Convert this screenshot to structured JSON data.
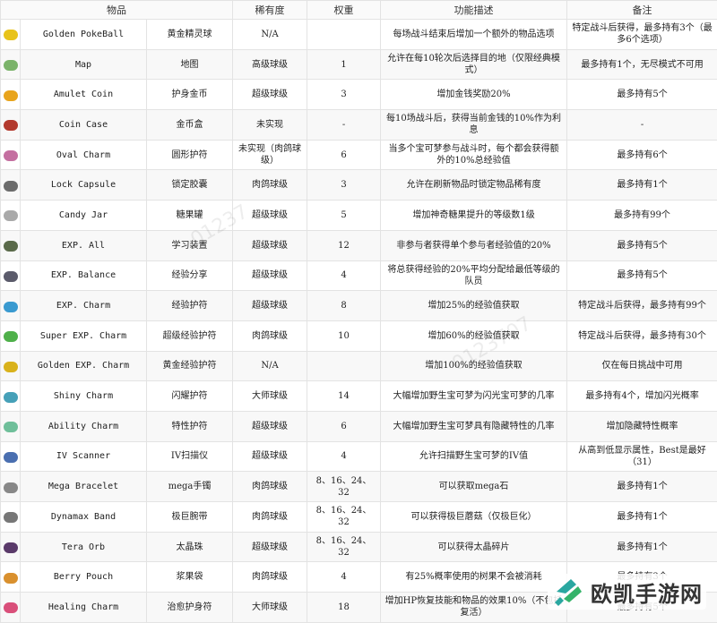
{
  "table": {
    "headers": [
      "物品",
      "稀有度",
      "权重",
      "功能描述",
      "备注"
    ],
    "rows": [
      {
        "icon": "golden-pokeball-icon",
        "color": "#e8c31a",
        "en": "Golden PokeBall",
        "zh": "黄金精灵球",
        "rarity": "N/A",
        "weight": "",
        "desc": "每场战斗结束后增加一个额外的物品选项",
        "note": "特定战斗后获得，最多持有3个（最多6个选项）"
      },
      {
        "icon": "map-icon",
        "color": "#7bb36a",
        "en": "Map",
        "zh": "地图",
        "rarity": "高级球级",
        "weight": "1",
        "desc": "允许在每10轮次后选择目的地（仅限经典模式）",
        "note": "最多持有1个，无尽模式不可用"
      },
      {
        "icon": "amulet-coin-icon",
        "color": "#e8a41c",
        "en": "Amulet Coin",
        "zh": "护身金币",
        "rarity": "超级球级",
        "weight": "3",
        "desc": "增加金钱奖励20%",
        "note": "最多持有5个"
      },
      {
        "icon": "coin-case-icon",
        "color": "#b33a2e",
        "en": "Coin Case",
        "zh": "金币盒",
        "rarity": "未实现",
        "weight": "-",
        "desc": "每10场战斗后，获得当前金钱的10%作为利息",
        "note": "-"
      },
      {
        "icon": "oval-charm-icon",
        "color": "#c46fa0",
        "en": "Oval Charm",
        "zh": "圆形护符",
        "rarity": "未实现（肉鸽球级）",
        "weight": "6",
        "desc": "当多个宝可梦参与战斗时，每个都会获得额外的10%总经验值",
        "note": "最多持有6个"
      },
      {
        "icon": "lock-capsule-icon",
        "color": "#6c6c6c",
        "en": "Lock Capsule",
        "zh": "锁定胶囊",
        "rarity": "肉鸽球级",
        "weight": "3",
        "desc": "允许在刷新物品时锁定物品稀有度",
        "note": "最多持有1个"
      },
      {
        "icon": "candy-jar-icon",
        "color": "#a9a9a9",
        "en": "Candy Jar",
        "zh": "糖果罐",
        "rarity": "超级球级",
        "weight": "5",
        "desc": "增加神奇糖果提升的等级数1级",
        "note": "最多持有99个"
      },
      {
        "icon": "exp-all-icon",
        "color": "#5a6a4a",
        "en": "EXP. All",
        "zh": "学习装置",
        "rarity": "超级球级",
        "weight": "12",
        "desc": "非参与者获得单个参与者经验值的20%",
        "note": "最多持有5个"
      },
      {
        "icon": "exp-balance-icon",
        "color": "#5b5b6b",
        "en": "EXP. Balance",
        "zh": "经验分享",
        "rarity": "超级球级",
        "weight": "4",
        "desc": "将总获得经验的20%平均分配给最低等级的队员",
        "note": "最多持有5个"
      },
      {
        "icon": "exp-charm-icon",
        "color": "#3a9ad0",
        "en": "EXP. Charm",
        "zh": "经验护符",
        "rarity": "超级球级",
        "weight": "8",
        "desc": "增加25%的经验值获取",
        "note": "特定战斗后获得，最多持有99个"
      },
      {
        "icon": "super-exp-charm-icon",
        "color": "#4fb04a",
        "en": "Super EXP. Charm",
        "zh": "超级经验护符",
        "rarity": "肉鸽球级",
        "weight": "10",
        "desc": "增加60%的经验值获取",
        "note": "特定战斗后获得，最多持有30个"
      },
      {
        "icon": "golden-exp-charm-icon",
        "color": "#d9b21c",
        "en": "Golden EXP. Charm",
        "zh": "黄金经验护符",
        "rarity": "N/A",
        "weight": "",
        "desc": "增加100%的经验值获取",
        "note": "仅在每日挑战中可用"
      },
      {
        "icon": "shiny-charm-icon",
        "color": "#46a0b8",
        "en": "Shiny Charm",
        "zh": "闪耀护符",
        "rarity": "大师球级",
        "weight": "14",
        "desc": "大幅增加野生宝可梦为闪光宝可梦的几率",
        "note": "最多持有4个，增加闪光概率"
      },
      {
        "icon": "ability-charm-icon",
        "color": "#6fbf9a",
        "en": "Ability Charm",
        "zh": "特性护符",
        "rarity": "超级球级",
        "weight": "6",
        "desc": "大幅增加野生宝可梦具有隐藏特性的几率",
        "note": "增加隐藏特性概率"
      },
      {
        "icon": "iv-scanner-icon",
        "color": "#4a6fb0",
        "en": "IV Scanner",
        "zh": "IV扫描仪",
        "rarity": "超级球级",
        "weight": "4",
        "desc": "允许扫描野生宝可梦的IV值",
        "note": "从高到低显示属性，Best是最好（31）"
      },
      {
        "icon": "mega-bracelet-icon",
        "color": "#888888",
        "en": "Mega Bracelet",
        "zh": "mega手镯",
        "rarity": "肉鸽球级",
        "weight": "8、16、24、32",
        "desc": "可以获取mega石",
        "note": "最多持有1个"
      },
      {
        "icon": "dynamax-band-icon",
        "color": "#777777",
        "en": "Dynamax Band",
        "zh": "极巨腕带",
        "rarity": "肉鸽球级",
        "weight": "8、16、24、32",
        "desc": "可以获得极巨蘑菇（仅极巨化）",
        "note": "最多持有1个"
      },
      {
        "icon": "tera-orb-icon",
        "color": "#5a3a6a",
        "en": "Tera Orb",
        "zh": "太晶珠",
        "rarity": "超级球级",
        "weight": "8、16、24、32",
        "desc": "可以获得太晶碎片",
        "note": "最多持有1个"
      },
      {
        "icon": "berry-pouch-icon",
        "color": "#d9902e",
        "en": "Berry Pouch",
        "zh": "浆果袋",
        "rarity": "肉鸽球级",
        "weight": "4",
        "desc": "有25%概率使用的树果不会被消耗",
        "note": "最多持有3个"
      },
      {
        "icon": "healing-charm-icon",
        "color": "#d94f7a",
        "en": "Healing Charm",
        "zh": "治愈护身符",
        "rarity": "大师球级",
        "weight": "18",
        "desc": "增加HP恢复技能和物品的效果10%（不包括复活）",
        "note": "最多持有5个"
      }
    ]
  },
  "watermark": {
    "text_a": "01237",
    "text_b": "0123707"
  },
  "logo": {
    "text": "欧凯手游网"
  }
}
